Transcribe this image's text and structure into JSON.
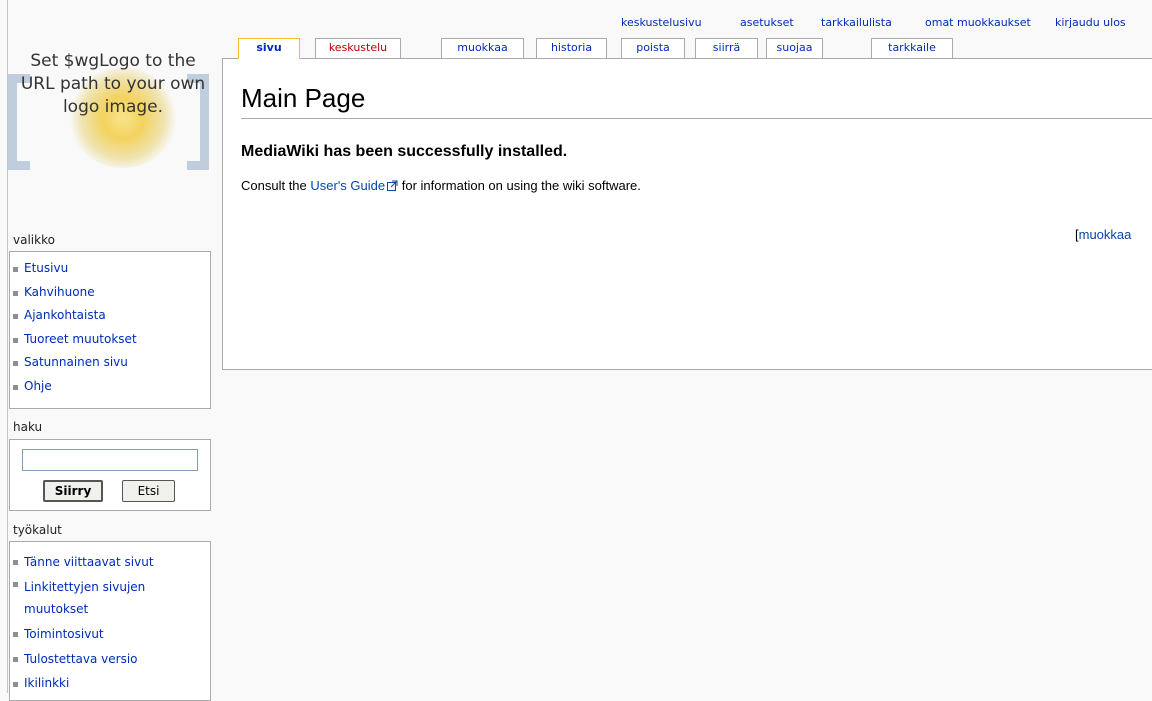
{
  "logo": {
    "text": "Set $wgLogo to the URL path to your own logo image."
  },
  "personal_tools": [
    {
      "label": "keskustelusivu"
    },
    {
      "label": "asetukset"
    },
    {
      "label": "tarkkailulista"
    },
    {
      "label": "omat muokkaukset"
    },
    {
      "label": "kirjaudu ulos"
    }
  ],
  "tabs": [
    {
      "label": "sivu",
      "selected": true
    },
    {
      "label": "keskustelu",
      "new": true
    },
    {
      "label": "muokkaa"
    },
    {
      "label": "historia"
    },
    {
      "label": "poista"
    },
    {
      "label": "siirrä"
    },
    {
      "label": "suojaa"
    },
    {
      "label": "tarkkaile"
    }
  ],
  "content": {
    "title": "Main Page",
    "heading": "MediaWiki has been successfully installed.",
    "consult_before": "Consult the ",
    "consult_link": "User's Guide",
    "consult_after": " for information on using the wiki software.",
    "edit_section_open": "[",
    "edit_section_label": "muokkaa"
  },
  "navigation": {
    "title": "valikko",
    "items": [
      {
        "label": "Etusivu"
      },
      {
        "label": "Kahvihuone"
      },
      {
        "label": "Ajankohtaista"
      },
      {
        "label": "Tuoreet muutokset"
      },
      {
        "label": "Satunnainen sivu"
      },
      {
        "label": "Ohje"
      }
    ]
  },
  "search": {
    "title": "haku",
    "value": "",
    "go_label": "Siirry",
    "search_label": "Etsi"
  },
  "toolbox": {
    "title": "työkalut",
    "items": [
      {
        "label": "Tänne viittaavat sivut"
      },
      {
        "label": "Linkitettyjen sivujen muutokset"
      },
      {
        "label": "Toimintosivut"
      },
      {
        "label": "Tulostettava versio"
      },
      {
        "label": "Ikilinkki"
      }
    ]
  },
  "colors": {
    "link": "#002bb8",
    "new_link": "#ba0000",
    "selected_tab_border": "#fabd23",
    "border": "#aaaaaa"
  }
}
